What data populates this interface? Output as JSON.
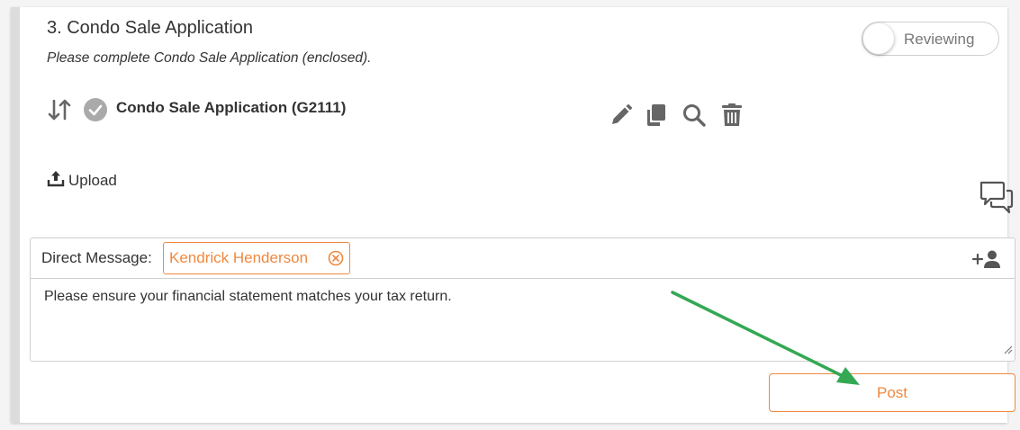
{
  "section": {
    "title": "3. Condo Sale Application",
    "subtitle": "Please complete Condo Sale Application (enclosed).",
    "status_toggle_label": "Reviewing",
    "status_toggle_on": false
  },
  "document": {
    "name": "Condo Sale Application (G2111)",
    "icons": [
      "sort-arrows-icon",
      "check-circle-icon",
      "pencil-icon",
      "copy-icon",
      "search-icon",
      "trash-icon"
    ]
  },
  "upload": {
    "label": "Upload",
    "icon": "upload-icon"
  },
  "direct_message": {
    "label": "Direct Message:",
    "recipient": "Kendrick Henderson",
    "message": "Please ensure your financial statement matches your tax return."
  },
  "actions": {
    "post_label": "Post"
  },
  "colors": {
    "accent": "#f0883e",
    "icon_gray": "#666666",
    "check_gray": "#aaaaaa",
    "annotation_arrow": "#34a853"
  }
}
